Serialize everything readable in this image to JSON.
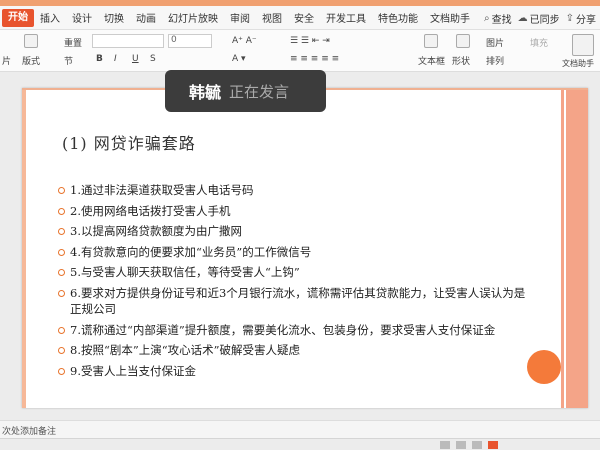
{
  "menu": {
    "items": [
      "开始",
      "插入",
      "设计",
      "切换",
      "动画",
      "幻灯片放映",
      "审阅",
      "视图",
      "安全",
      "开发工具",
      "特色功能",
      "文档助手"
    ],
    "search": "查找",
    "sync": "已同步",
    "share": "分享"
  },
  "toolbar": {
    "reset": "重置",
    "layout": "版式",
    "section": "节",
    "font_size": "0",
    "textbox": "文本框",
    "shape": "形状",
    "image": "图片",
    "arrange": "排列",
    "fill": "填充",
    "doc_helper": "文档助手",
    "paste_fragment": "片"
  },
  "speaker": {
    "name": "韩毓",
    "status": "正在发言"
  },
  "slide": {
    "title": "(1) 网贷诈骗套路",
    "bullets": [
      "1.通过非法渠道获取受害人电话号码",
      "2.使用网络电话拨打受害人手机",
      "3.以提高网络贷款额度为由广撒网",
      "4.有贷款意向的便要求加“业务员”的工作微信号",
      "5.与受害人聊天获取信任，等待受害人“上钩”",
      "6.要求对方提供身份证号和近3个月银行流水，谎称需评估其贷款能力，让受害人误认为是正规公司",
      "7.谎称通过“内部渠道”提升额度，需要美化流水、包装身份，要求受害人支付保证金",
      "8.按照“剧本”上演“攻心话术”破解受害人疑虑",
      "9.受害人上当支付保证金"
    ]
  },
  "notes": {
    "placeholder": "次处添加备注"
  },
  "colors": {
    "accent": "#e8542e",
    "slide_bar": "#f4a488",
    "bullet": "#e8752e"
  }
}
